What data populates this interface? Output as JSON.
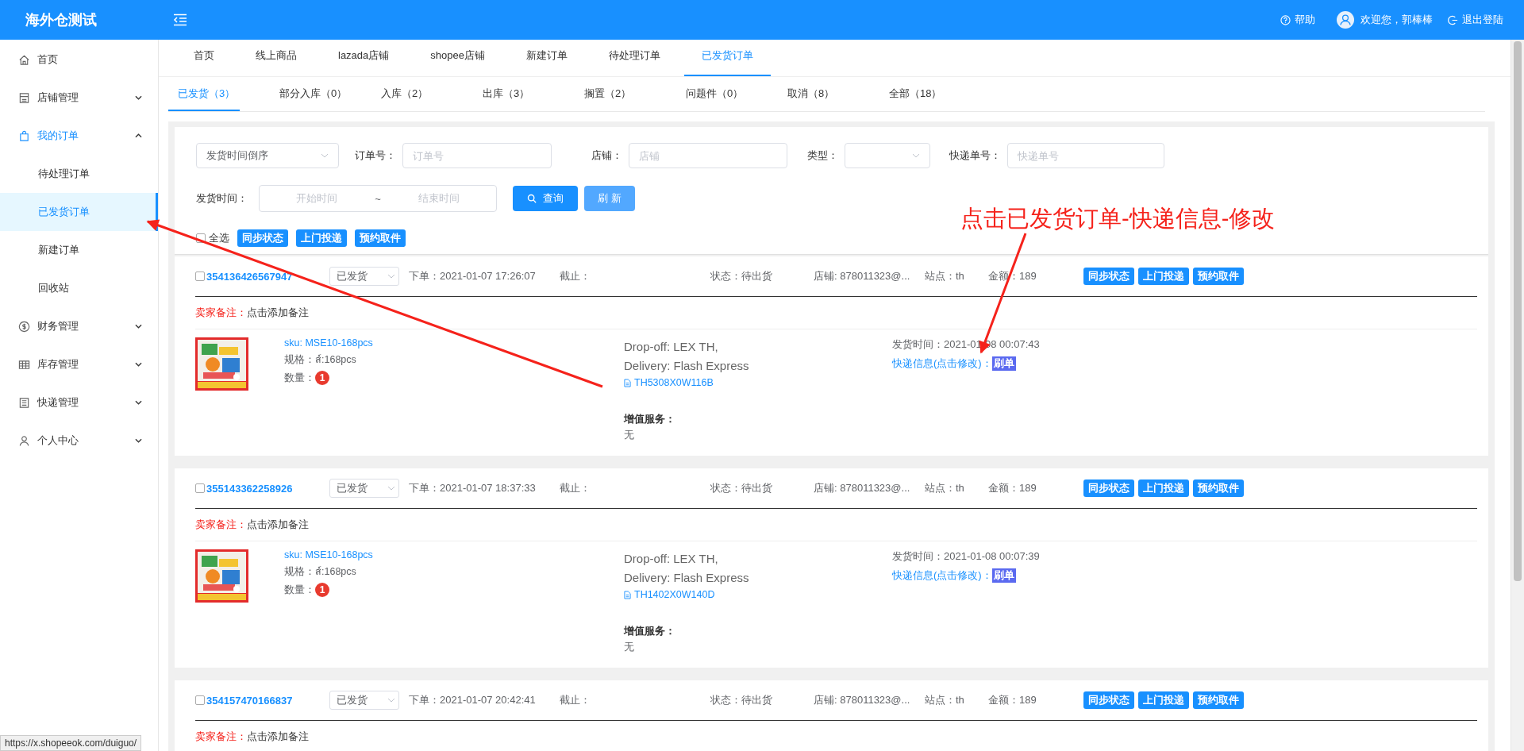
{
  "app": {
    "logo": "海外仓测试"
  },
  "header": {
    "help": "帮助",
    "welcome": "欢迎您，郭棒棒",
    "logout": "退出登陆"
  },
  "sidebar": {
    "items": [
      {
        "label": "首页",
        "selected": false
      },
      {
        "label": "店铺管理",
        "selected": false,
        "expanded": false
      },
      {
        "label": "我的订单",
        "selected": true,
        "expanded": true,
        "children": [
          {
            "label": "待处理订单",
            "selected": false
          },
          {
            "label": "已发货订单",
            "selected": true
          },
          {
            "label": "新建订单",
            "selected": false
          },
          {
            "label": "回收站",
            "selected": false
          }
        ]
      },
      {
        "label": "财务管理",
        "selected": false,
        "expanded": false
      },
      {
        "label": "库存管理",
        "selected": false,
        "expanded": false
      },
      {
        "label": "快递管理",
        "selected": false,
        "expanded": false
      },
      {
        "label": "个人中心",
        "selected": false,
        "expanded": false
      }
    ]
  },
  "top_tabs": [
    {
      "label": "首页",
      "selected": false
    },
    {
      "label": "线上商品",
      "selected": false
    },
    {
      "label": "lazada店铺",
      "selected": false
    },
    {
      "label": "shopee店铺",
      "selected": false
    },
    {
      "label": "新建订单",
      "selected": false
    },
    {
      "label": "待处理订单",
      "selected": false
    },
    {
      "label": "已发货订单",
      "selected": true
    }
  ],
  "sub_tabs": [
    {
      "label": "已发货（3）",
      "selected": true
    },
    {
      "label": "部分入库（0）",
      "selected": false
    },
    {
      "label": "入库（2）",
      "selected": false
    },
    {
      "label": "出库（3）",
      "selected": false
    },
    {
      "label": "搁置（2）",
      "selected": false
    },
    {
      "label": "问题件（0）",
      "selected": false
    },
    {
      "label": "取消（8）",
      "selected": false
    },
    {
      "label": "全部（18）",
      "selected": false
    }
  ],
  "filters": {
    "sort_select": {
      "value": "发货时间倒序"
    },
    "order_no": {
      "label": "订单号：",
      "placeholder": "订单号"
    },
    "shop": {
      "label": "店铺：",
      "placeholder": "店铺"
    },
    "type": {
      "label": "类型："
    },
    "tracking": {
      "label": "快递单号：",
      "placeholder": "快递单号"
    },
    "ship_time": {
      "label": "发货时间：",
      "start_placeholder": "开始时间",
      "separator": "~",
      "end_placeholder": "结束时间"
    },
    "search_button": "查询",
    "refresh_button": "刷 新"
  },
  "bulk": {
    "select_all": {
      "label": "全选",
      "checked": false
    },
    "buttons": [
      "同步状态",
      "上门投递",
      "预约取件"
    ]
  },
  "orders": [
    {
      "checked": false,
      "order_no": "354136426567947",
      "status": "已发货",
      "placed_label": "下单：",
      "placed": "2021-01-07 17:26:07",
      "deadline_label": "截止：",
      "state_label": "状态：",
      "state": "待出货",
      "shop": "店铺: 878011323@...",
      "site_label": "站点：",
      "site": "th",
      "amount_label": "金额：",
      "amount": "189",
      "buttons": [
        "同步状态",
        "上门投递",
        "预约取件"
      ],
      "remark_label": "卖家备注：",
      "remark": "点击添加备注",
      "item": {
        "sku": "sku: MSE10-168pcs",
        "spec_label": "规格：",
        "spec": "ส์:168pcs",
        "qty_label": "数量：",
        "qty": "1",
        "dropoff": "Drop-off: LEX TH,",
        "delivery": "Delivery: Flash Express",
        "tracking": "TH5308X0W116B",
        "vas_label": "增值服务：",
        "vas": "无",
        "ship_label": "发货时间：",
        "ship_time": "2021-01-08 00:07:43",
        "express_link": "快递信息(点击修改)：",
        "badge": "刷单"
      }
    },
    {
      "checked": false,
      "order_no": "355143362258926",
      "status": "已发货",
      "placed_label": "下单：",
      "placed": "2021-01-07 18:37:33",
      "deadline_label": "截止：",
      "state_label": "状态：",
      "state": "待出货",
      "shop": "店铺: 878011323@...",
      "site_label": "站点：",
      "site": "th",
      "amount_label": "金额：",
      "amount": "189",
      "buttons": [
        "同步状态",
        "上门投递",
        "预约取件"
      ],
      "remark_label": "卖家备注：",
      "remark": "点击添加备注",
      "item": {
        "sku": "sku: MSE10-168pcs",
        "spec_label": "规格：",
        "spec": "ส์:168pcs",
        "qty_label": "数量：",
        "qty": "1",
        "dropoff": "Drop-off: LEX TH,",
        "delivery": "Delivery: Flash Express",
        "tracking": "TH1402X0W140D",
        "vas_label": "增值服务：",
        "vas": "无",
        "ship_label": "发货时间：",
        "ship_time": "2021-01-08 00:07:39",
        "express_link": "快递信息(点击修改)：",
        "badge": "刷单"
      }
    },
    {
      "checked": false,
      "order_no": "354157470166837",
      "status": "已发货",
      "placed_label": "下单：",
      "placed": "2021-01-07 20:42:41",
      "deadline_label": "截止：",
      "state_label": "状态：",
      "state": "待出货",
      "shop": "店铺: 878011323@...",
      "site_label": "站点：",
      "site": "th",
      "amount_label": "金额：",
      "amount": "189",
      "buttons": [
        "同步状态",
        "上门投递",
        "预约取件"
      ],
      "remark_label": "卖家备注：",
      "remark": "点击添加备注"
    }
  ],
  "annotation": {
    "text": "点击已发货订单-快递信息-修改"
  },
  "status_url": "https://x.shopeeok.com/duiguo/"
}
